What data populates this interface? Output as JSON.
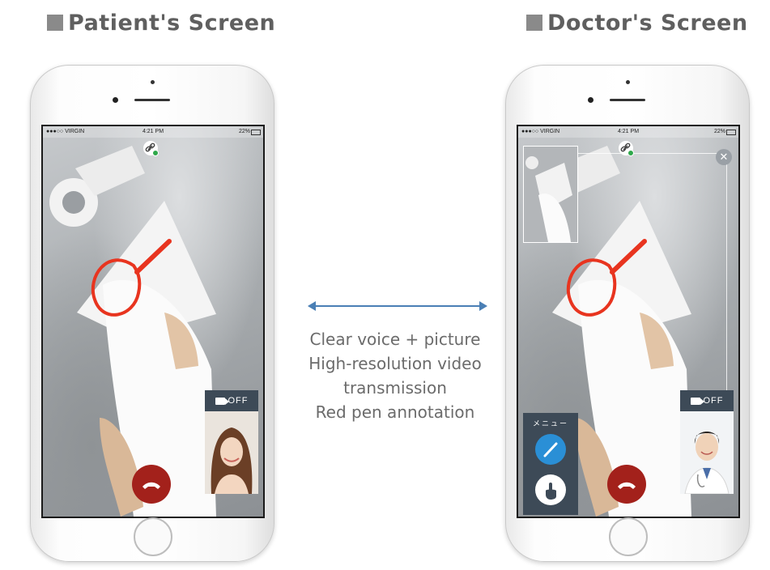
{
  "patient": {
    "heading": "Patient's Screen",
    "status": {
      "carrier": "●●●○○ VIRGIN",
      "time": "4:21 PM",
      "battery": "22%"
    },
    "camera_toggle_label": "OFF"
  },
  "doctor": {
    "heading": "Doctor's Screen",
    "status": {
      "carrier": "●●●○○ VIRGIN",
      "time": "4:21 PM",
      "battery": "22%"
    },
    "camera_toggle_label": "OFF",
    "menu_label": "メニュー",
    "close_glyph": "✕"
  },
  "features": [
    "Clear voice + picture",
    "High-resolution video",
    "transmission",
    "Red pen annotation"
  ],
  "colors": {
    "accent_red": "#e8341f",
    "end_call": "#a3211b",
    "pen_blue": "#2a8fd6",
    "arrow_blue": "#4a7fb5",
    "panel_dark": "#3d4a57"
  },
  "icons": [
    "link-icon",
    "video-camera-icon",
    "end-call-icon",
    "pen-icon",
    "pointer-hand-icon",
    "close-icon",
    "bidirectional-arrow-icon"
  ]
}
